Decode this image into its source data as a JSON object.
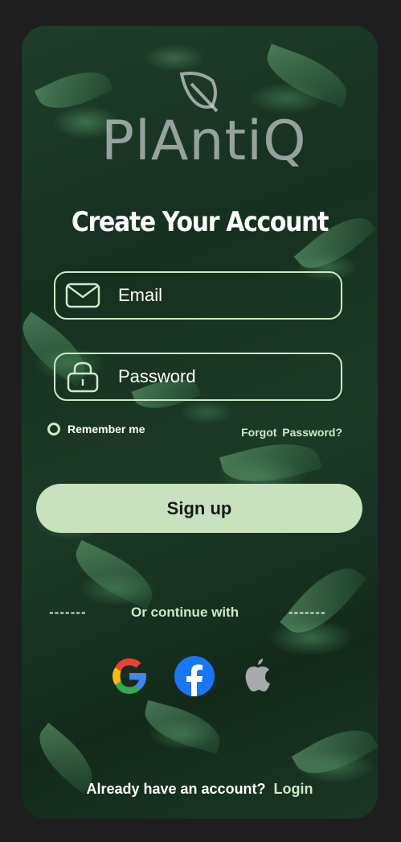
{
  "brand": {
    "logo_text": "PlAntiQ"
  },
  "form": {
    "title": "Create Your Account",
    "email_placeholder": "Email",
    "password_placeholder": "Password",
    "remember_label": "Remember me",
    "forgot_label": "Forgot  Password?",
    "submit_label": "Sign up"
  },
  "social": {
    "dash_left": "-------",
    "dash_right": "-------",
    "divider_text": "Or continue with",
    "providers": [
      {
        "name": "google",
        "icon": "google-icon"
      },
      {
        "name": "facebook",
        "icon": "facebook-icon"
      },
      {
        "name": "apple",
        "icon": "apple-icon"
      }
    ]
  },
  "footer": {
    "prompt": "Already have an account?",
    "login_label": "Login"
  },
  "colors": {
    "accent": "#c7e2bd",
    "outline": "#cfe8c7",
    "background": "#1e1e1e",
    "text": "#ffffff"
  }
}
